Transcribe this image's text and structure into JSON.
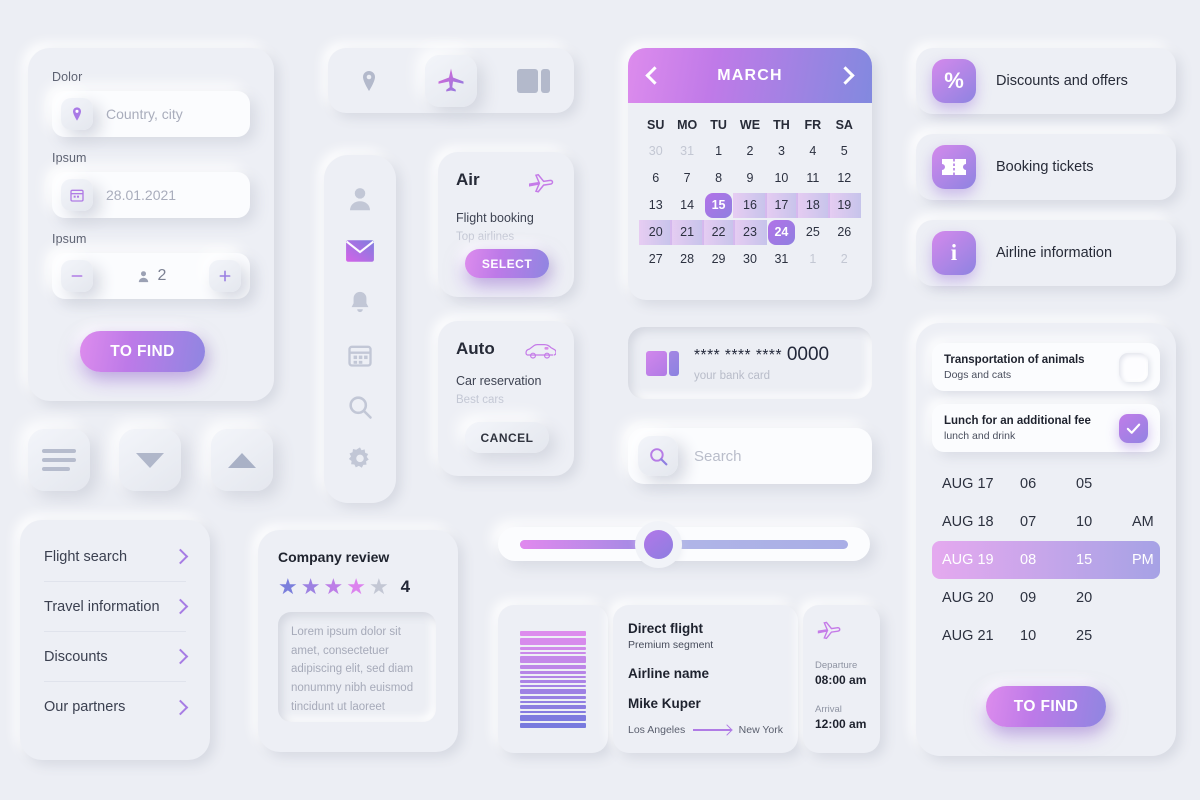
{
  "search_panel": {
    "labels": {
      "destination": "Dolor",
      "date": "Ipsum",
      "passengers": "Ipsum"
    },
    "destination_placeholder": "Country, city",
    "date_value": "28.01.2021",
    "passenger_count": "2",
    "minus_label": "−",
    "plus_label": "+",
    "submit_label": "TO FIND",
    "icons": {
      "pin": "location-pin-icon",
      "calendar": "calendar-icon",
      "person": "person-icon"
    }
  },
  "square_buttons": [
    {
      "name": "menu-button",
      "icon": "hamburger-icon"
    },
    {
      "name": "collapse-button",
      "icon": "chevron-down-icon"
    },
    {
      "name": "expand-button",
      "icon": "chevron-up-icon"
    }
  ],
  "nav_list": {
    "items": [
      {
        "label": "Flight search"
      },
      {
        "label": "Travel information"
      },
      {
        "label": "Discounts"
      },
      {
        "label": "Our partners"
      }
    ]
  },
  "tabbar": {
    "tabs": [
      {
        "icon": "location-pin-icon",
        "active": false
      },
      {
        "icon": "airplane-icon",
        "active": true
      },
      {
        "icon": "card-icon",
        "active": false
      }
    ]
  },
  "rail": {
    "items": [
      {
        "icon": "person-icon",
        "active": false
      },
      {
        "icon": "mail-icon",
        "active": true
      },
      {
        "icon": "bell-icon",
        "active": false
      },
      {
        "icon": "calendar-icon",
        "active": false
      },
      {
        "icon": "search-icon",
        "active": false
      },
      {
        "icon": "gear-icon",
        "active": false
      }
    ]
  },
  "service_cards": [
    {
      "title": "Air",
      "subtitle": "Flight booking",
      "note": "Top airlines",
      "button": "SELECT",
      "icon": "airplane-outline-icon"
    },
    {
      "title": "Auto",
      "subtitle": "Car reservation",
      "note": "Best cars",
      "button": "CANCEL",
      "icon": "car-outline-icon"
    }
  ],
  "review": {
    "title": "Company review",
    "rating": "4",
    "stars_filled": 4,
    "stars_total": 5,
    "star_colors": [
      "#7b7fdc",
      "#9d81e2",
      "#bd7ee7",
      "#dc83ee",
      "#c3c7d4"
    ],
    "text": "Lorem ipsum dolor sit amet, consectetuer adipiscing elit, sed diam nonummy nibh euismod tincidunt ut laoreet"
  },
  "calendar": {
    "month": "MARCH",
    "prev_label": "previous-month",
    "next_label": "next-month",
    "dow": [
      "SU",
      "MO",
      "TU",
      "WE",
      "TH",
      "FR",
      "SA"
    ],
    "days": [
      {
        "d": "30",
        "muted": true
      },
      {
        "d": "31",
        "muted": true
      },
      {
        "d": "1"
      },
      {
        "d": "2"
      },
      {
        "d": "3"
      },
      {
        "d": "4"
      },
      {
        "d": "5"
      },
      {
        "d": "6"
      },
      {
        "d": "7"
      },
      {
        "d": "8"
      },
      {
        "d": "9"
      },
      {
        "d": "10"
      },
      {
        "d": "11"
      },
      {
        "d": "12"
      },
      {
        "d": "13"
      },
      {
        "d": "14"
      },
      {
        "d": "15",
        "selected": true
      },
      {
        "d": "16",
        "range": true
      },
      {
        "d": "17",
        "range": true
      },
      {
        "d": "18",
        "range": true
      },
      {
        "d": "19",
        "range": true
      },
      {
        "d": "20",
        "range": true
      },
      {
        "d": "21",
        "range": true
      },
      {
        "d": "22",
        "range": true
      },
      {
        "d": "23",
        "range": true
      },
      {
        "d": "24",
        "selected": true
      },
      {
        "d": "25"
      },
      {
        "d": "26"
      },
      {
        "d": "27"
      },
      {
        "d": "28"
      },
      {
        "d": "29"
      },
      {
        "d": "30"
      },
      {
        "d": "31"
      },
      {
        "d": "1",
        "muted": true
      },
      {
        "d": "2",
        "muted": true
      }
    ]
  },
  "bank_card": {
    "masked": "**** **** ****",
    "last4": "0000",
    "caption": "your bank card",
    "icon": "card-icon"
  },
  "search": {
    "placeholder": "Search",
    "icon": "search-icon"
  },
  "slider": {
    "value_percent": 42
  },
  "boarding_pass": {
    "flight_type": "Direct flight",
    "segment": "Premium segment",
    "airline": "Airline name",
    "passenger": "Mike Kuper",
    "from": "Los Angeles",
    "to": "New York",
    "departure_label": "Departure",
    "departure_time": "08:00 am",
    "arrival_label": "Arrival",
    "arrival_time": "12:00 am",
    "icon": "airplane-outline-icon"
  },
  "menu_cards": [
    {
      "label": "Discounts and offers",
      "icon": "percent-icon",
      "glyph": "%"
    },
    {
      "label": "Booking tickets",
      "icon": "ticket-icon",
      "glyph": ""
    },
    {
      "label": "Airline information",
      "icon": "info-icon",
      "glyph": "i"
    }
  ],
  "options": {
    "checkboxes": [
      {
        "title": "Transportation of animals",
        "subtitle": "Dogs and cats",
        "checked": false
      },
      {
        "title": "Lunch for an additional fee",
        "subtitle": "lunch and drink",
        "checked": true
      }
    ],
    "time_table": [
      {
        "date": "AUG 17",
        "h": "06",
        "m": "05",
        "mer": "",
        "selected": false
      },
      {
        "date": "AUG 18",
        "h": "07",
        "m": "10",
        "mer": "AM",
        "selected": false
      },
      {
        "date": "AUG 19",
        "h": "08",
        "m": "15",
        "mer": "PM",
        "selected": true
      },
      {
        "date": "AUG 20",
        "h": "09",
        "m": "20",
        "mer": "",
        "selected": false
      },
      {
        "date": "AUG 21",
        "h": "10",
        "m": "25",
        "mer": "",
        "selected": false
      }
    ],
    "submit_label": "TO FIND"
  },
  "colors": {
    "background": "#eceef4",
    "accent_pink": "#dd8ced",
    "accent_purple": "#b27ae8",
    "accent_indigo": "#8289df",
    "text_dark": "#272b38",
    "text_muted": "#a9adbc"
  }
}
